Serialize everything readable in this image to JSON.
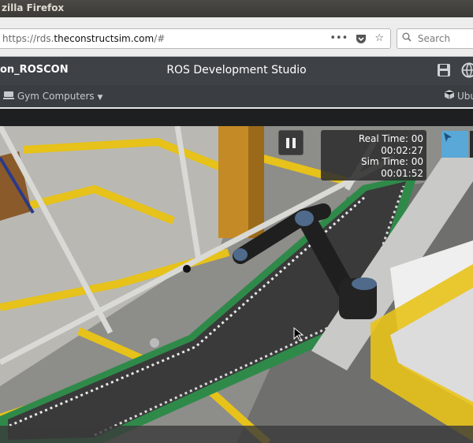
{
  "window": {
    "title": "zilla Firefox"
  },
  "browser": {
    "url_prefix": "https://rds.",
    "url_domain": "theconstructsim.com",
    "url_suffix": "/#",
    "search_placeholder": "Search",
    "icons": [
      "more-dots-icon",
      "pocket-icon",
      "bookmark-star-icon",
      "search-icon"
    ]
  },
  "app": {
    "project_name": "on_ROSCON",
    "title": "ROS Development Studio",
    "gym_label": "Gym Computers",
    "ubuntu_label": "Ubu",
    "icons": [
      "save-icon",
      "globe-icon",
      "computer-icon",
      "dropdown-caret-icon",
      "cube-icon"
    ]
  },
  "simulation": {
    "real_time_label": "Real Time: 00",
    "real_time_value": "00:02:27",
    "sim_time_label": "Sim Time: 00",
    "sim_time_value": "00:01:52",
    "icons": [
      "pause-icon",
      "select-arrow-icon",
      "mouse-cursor-icon"
    ],
    "colors": {
      "floor_line": "#e6c21a",
      "conveyor_frame": "#2f8a4a",
      "conveyor_belt": "#3a3a3a",
      "robot_arm": "#1f1f1f",
      "robot_joint": "#4f6a8a",
      "pillar": "#c48a26"
    }
  }
}
